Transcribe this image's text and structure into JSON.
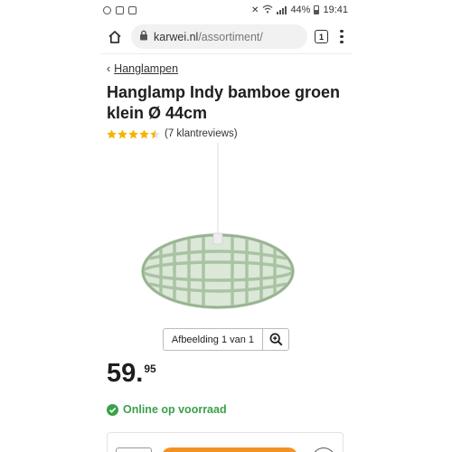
{
  "statusbar": {
    "battery": "44%",
    "time": "19:41"
  },
  "browser": {
    "url_host": "karwei.nl",
    "url_path": "/assortiment/",
    "tab_count": "1"
  },
  "breadcrumb": {
    "label": "Hanglampen"
  },
  "product": {
    "title": "Hanglamp Indy bamboe groen klein Ø 44cm",
    "rating_value": 4.5,
    "rating_max": 5,
    "reviews_label": "(7 klantreviews)",
    "image_counter": "Afbeelding 1 van 1",
    "price_whole": "59",
    "price_dot": ".",
    "price_cents": "95",
    "stock_label": "Online op voorraad"
  },
  "colors": {
    "star": "#f5b400",
    "stock": "#3aa14a",
    "cta": "#f29222",
    "lamp": "#a9c3a3"
  },
  "icons": {
    "home": "home-icon",
    "lock": "lock-icon",
    "tabs": "tabs-icon",
    "menu": "more-vert-icon",
    "zoom": "zoom-in-icon",
    "check": "check-circle-icon"
  }
}
